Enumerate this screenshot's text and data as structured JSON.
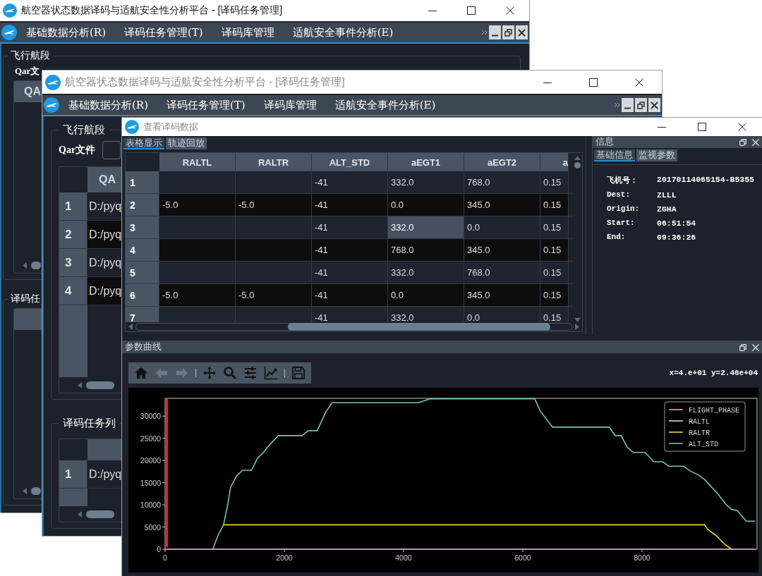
{
  "windows": [
    {
      "title": "航空器状态数据译码与适航安全性分析平台 - [译码任务管理]",
      "active": true,
      "menu": [
        "基础数据分析(R)",
        "译码任务管理(T)",
        "译码库管理",
        "适航安全事件分析(E)"
      ],
      "flight_group": {
        "title": "飞行航段",
        "file_label": "Qar文",
        "table_header": "QA"
      },
      "task_group": {
        "title": "译码任"
      }
    },
    {
      "title": "航空器状态数据译码与适航安全性分析平台 - [译码任务管理]",
      "active": false,
      "menu": [
        "基础数据分析(R)",
        "译码任务管理(T)",
        "译码库管理",
        "适航安全事件分析(E)"
      ],
      "flight_group": {
        "title": "飞行航段",
        "file_label": "Qar文件",
        "table_header": "QA",
        "rows": [
          {
            "number": "1",
            "path": "D:/pyq"
          },
          {
            "number": "2",
            "path": "D:/pyq"
          },
          {
            "number": "3",
            "path": "D:/pyq"
          },
          {
            "number": "4",
            "path": "D:/pyq"
          }
        ]
      },
      "task_group": {
        "title": "译码任务列",
        "rows": [
          {
            "number": "1",
            "path": "D:/pyq"
          }
        ]
      }
    }
  ],
  "decode_window": {
    "title": "查看译码数据",
    "active": false,
    "table_tabs": [
      {
        "label": "表格显示",
        "selected": true
      },
      {
        "label": "轨迹回放",
        "selected": false
      }
    ],
    "table": {
      "columns": [
        "RALTL",
        "RALTR",
        "ALT_STD",
        "aEGT1",
        "aEGT2",
        "a"
      ],
      "rows": [
        {
          "number": "1",
          "cells": [
            {
              "selected": false
            },
            {
              "selected": false
            },
            {
              "text": "-41",
              "selected": false
            },
            {
              "text": "332.0",
              "selected": false
            },
            {
              "text": "768.0",
              "selected": false
            },
            {
              "text": "0.15",
              "selected": false
            }
          ]
        },
        {
          "number": "2",
          "cells": [
            {
              "text": "-5.0",
              "selected": false
            },
            {
              "text": "-5.0",
              "selected": false
            },
            {
              "text": "-41",
              "selected": false
            },
            {
              "text": "0.0",
              "selected": false
            },
            {
              "text": "345.0",
              "selected": false
            },
            {
              "text": "0.15",
              "selected": false
            }
          ]
        },
        {
          "number": "3",
          "cells": [
            {
              "selected": false
            },
            {
              "selected": false
            },
            {
              "text": "-41",
              "selected": false
            },
            {
              "text": "332.0",
              "selected": true
            },
            {
              "text": "0.0",
              "selected": false
            },
            {
              "text": "0.15",
              "selected": false
            }
          ]
        },
        {
          "number": "4",
          "cells": [
            {
              "selected": false
            },
            {
              "selected": false
            },
            {
              "text": "-41",
              "selected": false
            },
            {
              "text": "768.0",
              "selected": false
            },
            {
              "text": "345.0",
              "selected": false
            },
            {
              "text": "0.15",
              "selected": false
            }
          ]
        },
        {
          "number": "5",
          "cells": [
            {
              "selected": false
            },
            {
              "selected": false
            },
            {
              "text": "-41",
              "selected": false
            },
            {
              "text": "332.0",
              "selected": false
            },
            {
              "text": "768.0",
              "selected": false
            },
            {
              "text": "0.15",
              "selected": false
            }
          ]
        },
        {
          "number": "6",
          "cells": [
            {
              "text": "-5.0",
              "selected": false
            },
            {
              "text": "-5.0",
              "selected": false
            },
            {
              "text": "-41",
              "selected": false
            },
            {
              "text": "0.0",
              "selected": false
            },
            {
              "text": "345.0",
              "selected": false
            },
            {
              "text": "0.15",
              "selected": false
            }
          ]
        },
        {
          "number": "7",
          "cells": [
            {
              "selected": false
            },
            {
              "selected": false
            },
            {
              "text": "-41",
              "selected": false
            },
            {
              "text": "332.0",
              "selected": false
            },
            {
              "text": "0.0",
              "selected": false
            },
            {
              "text": "0.15",
              "selected": false
            }
          ]
        }
      ]
    },
    "info": {
      "title": "信息",
      "tabs": [
        {
          "label": "基础信息",
          "selected": true
        },
        {
          "label": "监视参数",
          "selected": false
        }
      ],
      "fields": [
        {
          "label": "飞机号：",
          "value": "20170114065154-B5355"
        },
        {
          "label": "Dest:",
          "value": "ZLLL"
        },
        {
          "label": "Origin:",
          "value": "ZGHA"
        },
        {
          "label": "Start:",
          "value": "06:51:54"
        },
        {
          "label": "End:",
          "value": "09:36:26"
        }
      ]
    },
    "plot": {
      "title": "参数曲线",
      "toolbar": [
        {
          "disabled": false
        },
        {
          "disabled": true
        },
        {
          "disabled": true
        },
        {
          "disabled": false
        },
        {
          "disabled": false
        },
        {
          "disabled": false
        },
        {
          "disabled": false
        },
        {
          "disabled": false
        }
      ],
      "coordinates": "x=4.e+01 y=2.46e+04",
      "chart_data": {
        "type": "line",
        "x": [
          0,
          800,
          900,
          980,
          1050,
          1100,
          1200,
          1300,
          1450,
          1550,
          1650,
          1750,
          1900,
          2300,
          2400,
          2550,
          2700,
          2800,
          4250,
          4450,
          6200,
          6300,
          6500,
          7450,
          7550,
          7650,
          7750,
          7850,
          8050,
          8200,
          8350,
          8450,
          8700,
          8800,
          8950,
          9050,
          9100,
          9200,
          9250,
          9300,
          9400,
          9500,
          9600,
          9750,
          9900
        ],
        "series": [
          {
            "name": "FLIGHT_PHASE",
            "color": "#d8a0d0",
            "values": [
              0,
              0,
              0,
              0,
              0,
              0,
              0,
              0,
              0,
              0,
              0,
              0,
              0,
              0,
              0,
              0,
              0,
              0,
              0,
              0,
              0,
              0,
              0,
              0,
              0,
              0,
              0,
              0,
              0,
              0,
              0,
              0,
              0,
              0,
              0,
              0,
              0,
              0,
              0,
              0,
              0,
              0,
              0,
              0,
              0
            ]
          },
          {
            "name": "RALTL",
            "color": "#c8e8a8",
            "values": [
              null,
              null,
              null,
              null,
              null,
              null,
              null,
              null,
              null,
              null,
              null,
              null,
              null,
              null,
              null,
              null,
              null,
              null,
              null,
              null,
              null,
              null,
              null,
              null,
              null,
              null,
              null,
              null,
              null,
              null,
              null,
              null,
              null,
              null,
              null,
              null,
              null,
              null,
              null,
              null,
              null,
              null,
              null,
              null,
              null
            ]
          },
          {
            "name": "RALTR",
            "color": "#e6d44e",
            "values": [
              null,
              null,
              null,
              5500,
              5500,
              5500,
              5500,
              5500,
              5500,
              5500,
              5500,
              5500,
              5500,
              5500,
              5500,
              5500,
              5500,
              5500,
              5500,
              5500,
              5500,
              5500,
              5500,
              5500,
              5500,
              5500,
              5500,
              5500,
              5500,
              5500,
              5500,
              5500,
              5500,
              5500,
              5500,
              5500,
              4500,
              3500,
              3000,
              2300,
              1000,
              0,
              null,
              null,
              null
            ]
          },
          {
            "name": "ALT_STD",
            "color": "#72c6b4",
            "values": [
              null,
              0,
              3500,
              5500,
              10000,
              14000,
              16500,
              17800,
              17800,
              20500,
              21800,
              23500,
              25600,
              25600,
              26700,
              26700,
              31000,
              33000,
              33000,
              33900,
              33900,
              31000,
              27500,
              27500,
              25600,
              25600,
              23000,
              21800,
              21800,
              19700,
              19700,
              18700,
              18700,
              17700,
              16700,
              15700,
              15000,
              13500,
              12800,
              12000,
              10200,
              9000,
              8700,
              6300,
              6300
            ]
          }
        ],
        "xlim": [
          0,
          9930
        ],
        "ylim": [
          0,
          34000
        ],
        "xticks": [
          0,
          2000,
          4000,
          6000,
          8000
        ],
        "yticks": [
          0,
          5000,
          10000,
          15000,
          20000,
          25000,
          30000
        ],
        "legend": "upper right",
        "ref_lines": [
          {
            "axis": "x",
            "value": 30,
            "color": "#e8261e"
          }
        ]
      }
    }
  }
}
